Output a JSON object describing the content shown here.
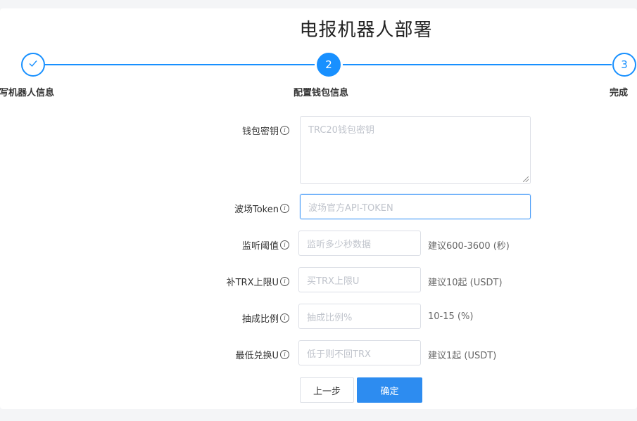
{
  "page": {
    "title": "电报机器人部署"
  },
  "steps": [
    {
      "number": "",
      "label": "填写机器人信息",
      "state": "done"
    },
    {
      "number": "2",
      "label": "配置钱包信息",
      "state": "active"
    },
    {
      "number": "3",
      "label": "完成",
      "state": "todo"
    }
  ],
  "form": {
    "wallet_key": {
      "label": "钱包密钥",
      "placeholder": "TRC20钱包密钥"
    },
    "tron_token": {
      "label": "波场Token",
      "placeholder": "波场官方API-TOKEN"
    },
    "listen_threshold": {
      "label": "监听阈值",
      "placeholder": "监听多少秒数据",
      "hint": "建议600-3600 (秒)"
    },
    "trx_limit": {
      "label": "补TRX上限U",
      "placeholder": "买TRX上限U",
      "hint": "建议10起 (USDT)"
    },
    "commission": {
      "label": "抽成比例",
      "placeholder": "抽成比例%",
      "hint": "10-15 (%)"
    },
    "min_exchange": {
      "label": "最低兑换U",
      "placeholder": "低于则不回TRX",
      "hint": "建议1起 (USDT)"
    }
  },
  "buttons": {
    "prev": "上一步",
    "confirm": "确定"
  },
  "colors": {
    "primary": "#1890ff",
    "button": "#2d8cf0"
  }
}
